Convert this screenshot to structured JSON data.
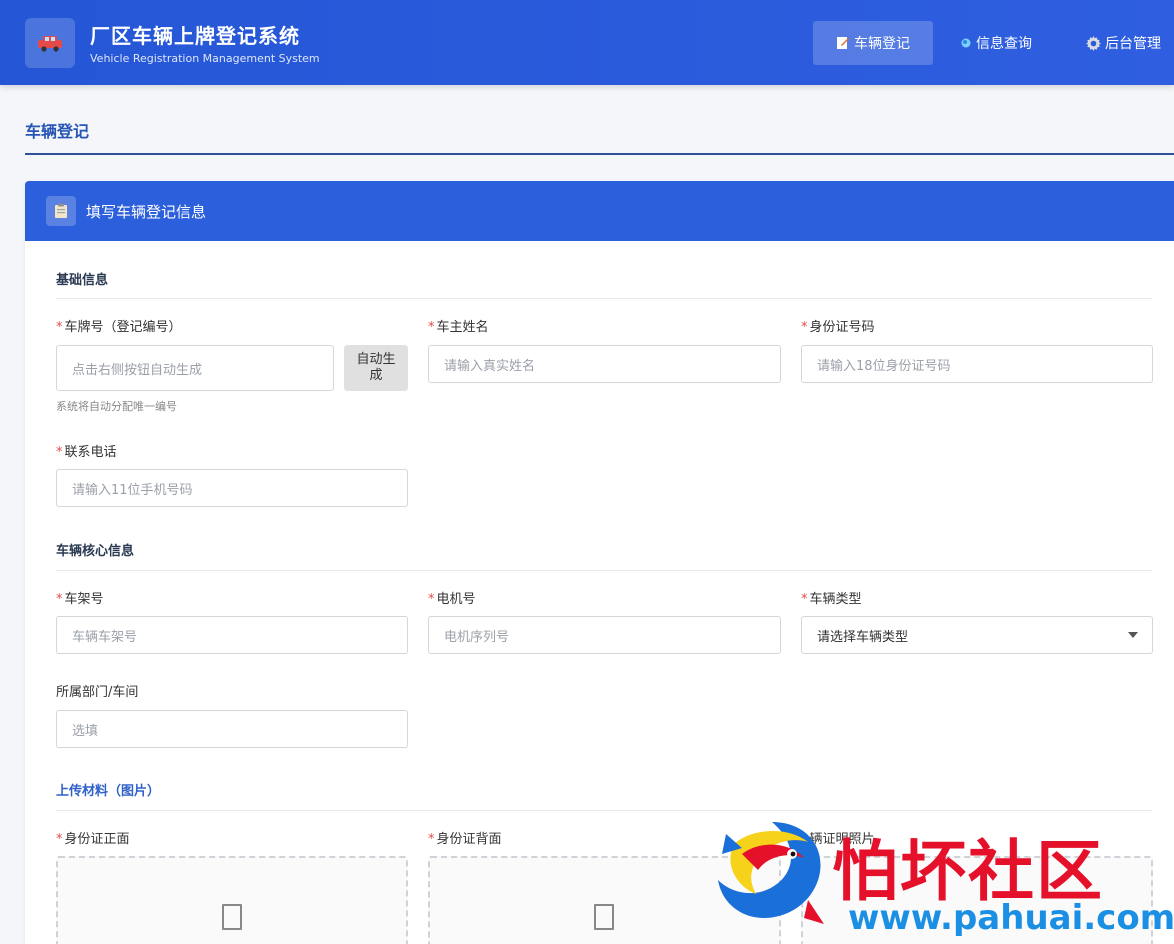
{
  "header": {
    "title": "厂区车辆上牌登记系统",
    "subtitle": "Vehicle Registration Management System",
    "nav": [
      {
        "label": "车辆登记",
        "icon": "edit-note-icon",
        "active": true
      },
      {
        "label": "信息查询",
        "icon": "search-dot-icon",
        "active": false
      },
      {
        "label": "后台管理",
        "icon": "gear-icon",
        "active": false
      }
    ]
  },
  "page": {
    "title": "车辆登记"
  },
  "card": {
    "title": "填写车辆登记信息"
  },
  "sections": {
    "basic": "基础信息",
    "core": "车辆核心信息",
    "upload": "上传材料（图片）"
  },
  "fields": {
    "plate": {
      "label": "车牌号（登记编号）",
      "placeholder": "点击右侧按钮自动生成",
      "button": "自动生成",
      "hint": "系统将自动分配唯一编号",
      "required": true
    },
    "owner": {
      "label": "车主姓名",
      "placeholder": "请输入真实姓名",
      "required": true
    },
    "idcard": {
      "label": "身份证号码",
      "placeholder": "请输入18位身份证号码",
      "required": true
    },
    "phone": {
      "label": "联系电话",
      "placeholder": "请输入11位手机号码",
      "required": true
    },
    "frame": {
      "label": "车架号",
      "placeholder": "车辆车架号",
      "required": true
    },
    "motor": {
      "label": "电机号",
      "placeholder": "电机序列号",
      "required": true
    },
    "type": {
      "label": "车辆类型",
      "value": "请选择车辆类型",
      "required": true
    },
    "dept": {
      "label": "所属部门/车间",
      "placeholder": "选填",
      "required": false
    }
  },
  "uploads": [
    {
      "label": "身份证正面",
      "required": true
    },
    {
      "label": "身份证背面",
      "required": true
    },
    {
      "label": "辆证明照片",
      "required": true
    }
  ],
  "watermark": {
    "text": "怕坏社区",
    "url": "www.pahuai.com"
  },
  "colors": {
    "primary": "#2c5fdc",
    "required": "#e14a4a",
    "watermark_red": "#e5102a",
    "watermark_blue": "#1a8fe3"
  }
}
